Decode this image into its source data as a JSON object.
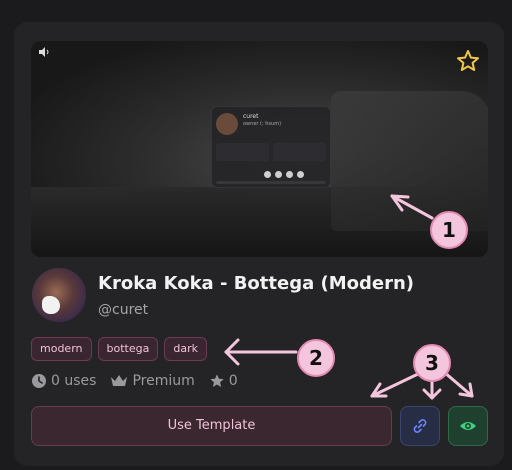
{
  "template": {
    "title": "Kroka Koka - Bottega (Modern)",
    "author": "@curet",
    "tags": [
      "modern",
      "bottega",
      "dark"
    ],
    "stats": {
      "uses": "0 uses",
      "tier": "Premium",
      "stars": "0"
    },
    "use_button_label": "Use Template"
  },
  "preview": {
    "card_name": "curet",
    "card_sub": "owner (: hsum)"
  },
  "annotations": [
    "1",
    "2",
    "3"
  ],
  "colors": {
    "accent_pink": "#f1c2d7",
    "annotation": "#f4c6dd",
    "star": "#f2c744",
    "link_blue": "#6f86ff",
    "view_green": "#3ed27f"
  },
  "icons": {
    "volume": "volume-icon",
    "favorite": "star-icon",
    "uses": "clock-icon",
    "tier": "crown-icon",
    "stars": "star-icon",
    "link": "link-icon",
    "view": "eye-icon"
  }
}
